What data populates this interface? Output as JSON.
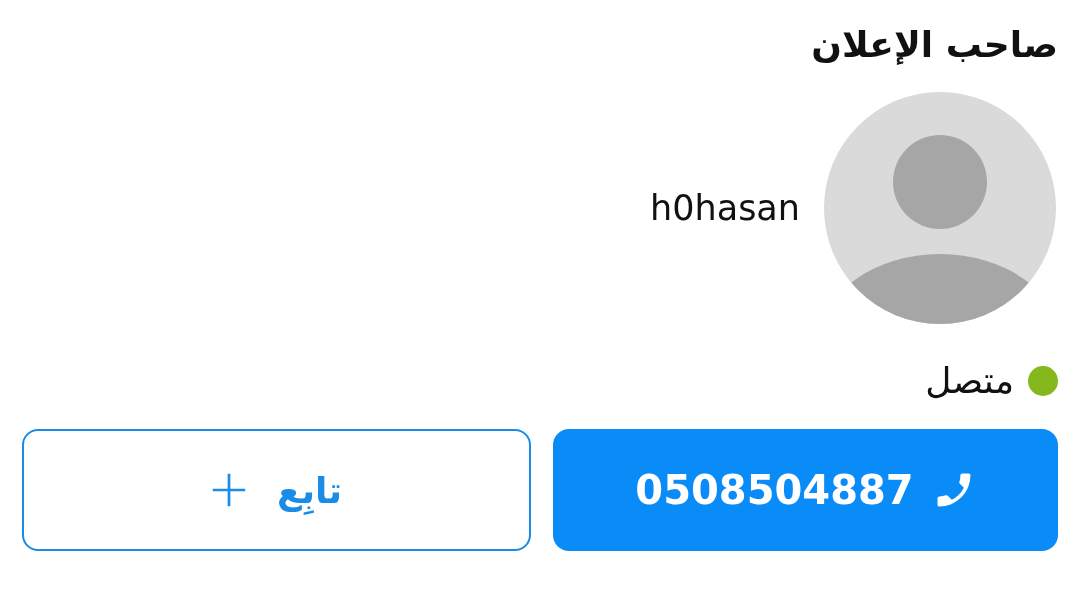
{
  "section_title": "صاحب الإعلان",
  "owner": {
    "username": "h0hasan"
  },
  "status": {
    "label": "متصل",
    "online": true
  },
  "buttons": [
    {
      "kind": "call",
      "label": "0508504887"
    },
    {
      "kind": "follow",
      "label": "تابِع"
    }
  ]
}
